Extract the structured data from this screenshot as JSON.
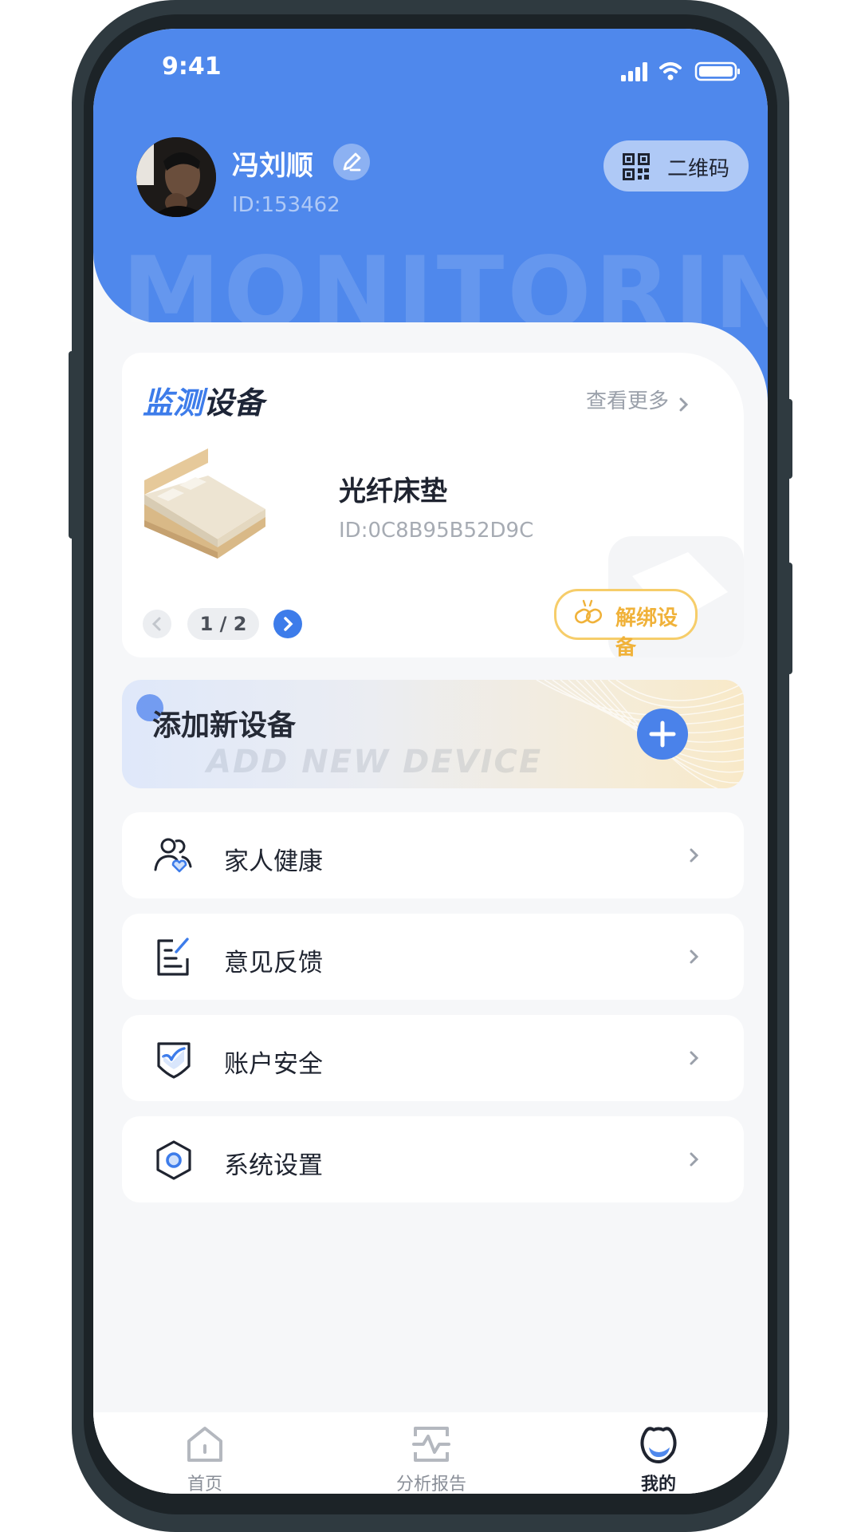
{
  "status_bar": {
    "time": "9:41"
  },
  "header": {
    "watermark": "MONITORING",
    "user_name": "冯刘顺",
    "user_id": "ID:153462",
    "qr_label": "二维码"
  },
  "device_section": {
    "title_part1": "监测",
    "title_part2": "设备",
    "more_label": "查看更多",
    "device_name": "光纤床垫",
    "device_id": "ID:0C8B95B52D9C",
    "pagination": "1 / 2",
    "unbind_label": "解绑设备"
  },
  "add_device": {
    "title": "添加新设备",
    "subtitle": "ADD NEW DEVICE"
  },
  "menu": [
    {
      "label": "家人健康",
      "icon": "family-health-icon"
    },
    {
      "label": "意见反馈",
      "icon": "feedback-icon"
    },
    {
      "label": "账户安全",
      "icon": "shield-check-icon"
    },
    {
      "label": "系统设置",
      "icon": "settings-hexagon-icon"
    }
  ],
  "tabs": [
    {
      "label": "首页",
      "icon": "home-icon",
      "active": false
    },
    {
      "label": "分析报告",
      "icon": "report-icon",
      "active": false
    },
    {
      "label": "我的",
      "icon": "profile-icon",
      "active": true
    }
  ],
  "colors": {
    "primary": "#4f88ec",
    "accent_gold": "#f0b23a",
    "background": "#f6f7f9"
  }
}
